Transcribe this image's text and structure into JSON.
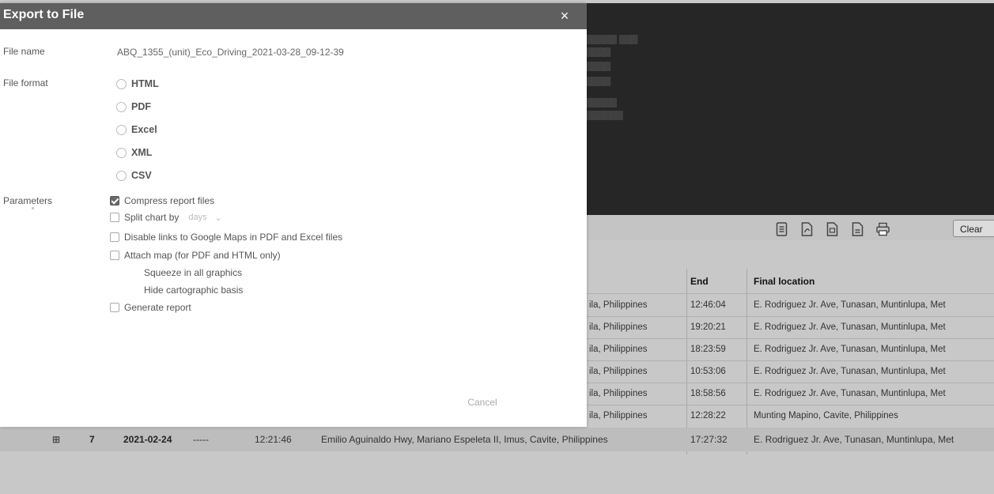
{
  "dialog": {
    "title": "Export to File",
    "close_label": "×",
    "file_name_label": "File name",
    "file_name_value": "ABQ_1355_(unit)_Eco_Driving_2021-03-28_09-12-39",
    "file_format_label": "File format",
    "formats": [
      "HTML",
      "PDF",
      "Excel",
      "XML",
      "CSV"
    ],
    "parameters_label": "Parameters",
    "params": {
      "compress": {
        "label": "Compress report files",
        "checked": true
      },
      "split_chart": {
        "label": "Split chart by",
        "checked": false,
        "select_value": "days"
      },
      "disable_links": {
        "label": "Disable links to Google Maps in PDF and Excel files",
        "checked": false
      },
      "attach_map": {
        "label": "Attach map (for PDF and HTML only)",
        "checked": false
      },
      "squeeze": "Squeeze in all graphics",
      "hide_basis": "Hide cartographic basis",
      "generate": {
        "label": "Generate report",
        "checked": false
      }
    },
    "cancel_label": "Cancel"
  },
  "background": {
    "toolbar_clear_label": "Clear",
    "toolbar_icons": [
      "list-icon",
      "pdf-icon",
      "excel-icon",
      "export-icon",
      "print-icon"
    ],
    "columns": {
      "end": "End",
      "final_location": "Final location"
    },
    "rows": [
      {
        "country": "ila, Philippines",
        "end": "12:46:04",
        "final": "E. Rodriguez Jr. Ave, Tunasan, Muntinlupa, Met"
      },
      {
        "country": "ila, Philippines",
        "end": "19:20:21",
        "final": "E. Rodriguez Jr. Ave, Tunasan, Muntinlupa, Met"
      },
      {
        "country": "ila, Philippines",
        "end": "18:23:59",
        "final": "E. Rodriguez Jr. Ave, Tunasan, Muntinlupa, Met"
      },
      {
        "country": "ila, Philippines",
        "end": "10:53:06",
        "final": "E. Rodriguez Jr. Ave, Tunasan, Muntinlupa, Met"
      },
      {
        "country": "ila, Philippines",
        "end": "18:58:56",
        "final": "E. Rodriguez Jr. Ave, Tunasan, Muntinlupa, Met"
      },
      {
        "country": "ila, Philippines",
        "end": "12:28:22",
        "final": "Munting Mapino, Cavite, Philippines"
      }
    ],
    "row7": {
      "expand": "⊞",
      "num": "7",
      "date": "2021-02-24",
      "dash": "-----",
      "start": "12:21:46",
      "initial": "Emilio Aguinaldo Hwy, Mariano Espeleta II, Imus, Cavite, Philippines",
      "end": "17:27:32",
      "final": "E. Rodriguez Jr. Ave, Tunasan, Muntinlupa, Met"
    }
  }
}
